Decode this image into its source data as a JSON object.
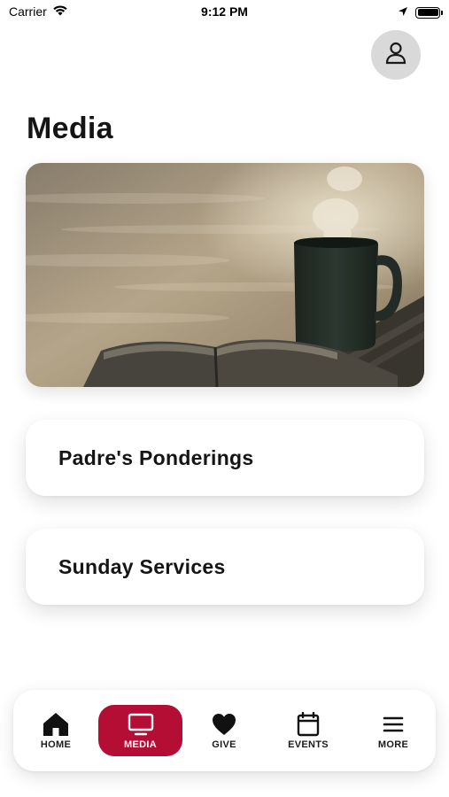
{
  "status_bar": {
    "carrier": "Carrier",
    "time": "9:12 PM",
    "icons": [
      "wifi-icon",
      "location-arrow-icon",
      "battery-icon"
    ]
  },
  "header": {
    "profile_icon": "user-icon"
  },
  "page": {
    "title": "Media"
  },
  "hero": {
    "image": "coffee-mug-and-open-bible"
  },
  "menu": [
    {
      "label": "Padre's Ponderings"
    },
    {
      "label": "Sunday Services"
    }
  ],
  "tab_bar": {
    "active_color": "#b50e34",
    "tabs": [
      {
        "label": "HOME",
        "icon": "home-icon"
      },
      {
        "label": "MEDIA",
        "icon": "tv-icon",
        "active": true
      },
      {
        "label": "GIVE",
        "icon": "heart-icon"
      },
      {
        "label": "EVENTS",
        "icon": "calendar-icon"
      },
      {
        "label": "MORE",
        "icon": "menu-icon"
      }
    ]
  }
}
